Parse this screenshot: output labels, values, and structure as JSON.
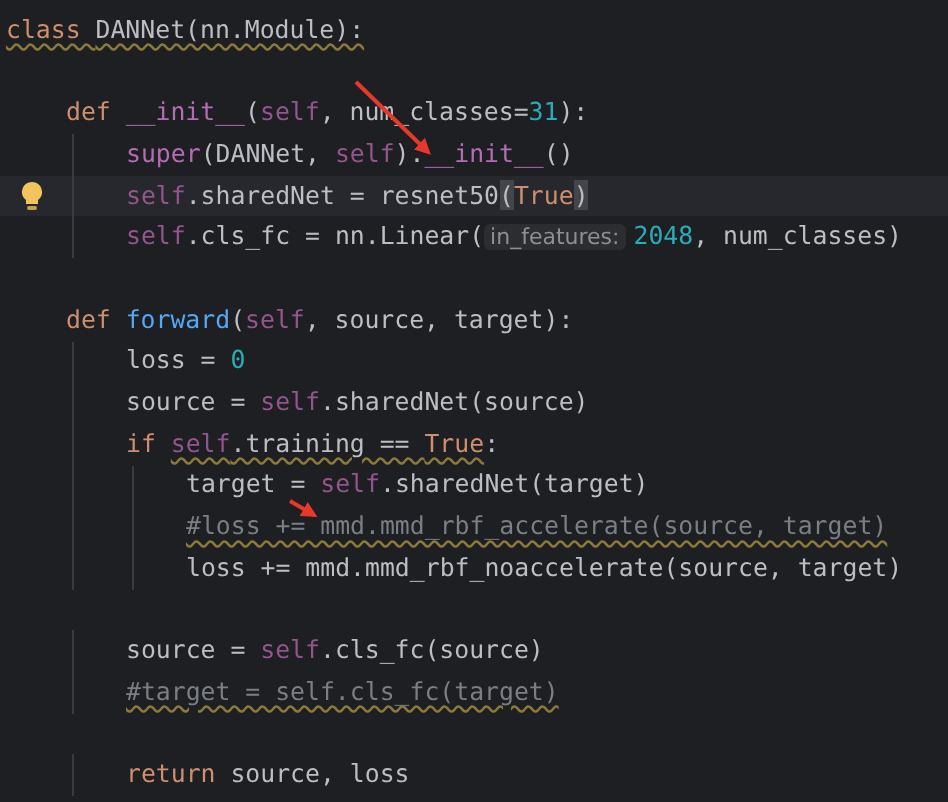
{
  "editor": {
    "lines": [
      {
        "kind": "code",
        "tokens": [
          {
            "t": "class ",
            "kind": "keyword",
            "warn": true
          },
          {
            "t": "DANNet(nn.Module):",
            "kind": "plain",
            "warn": true
          }
        ],
        "children": [
          {
            "kind": "blank"
          },
          {
            "kind": "code",
            "tokens": [
              {
                "t": "def ",
                "kind": "keyword"
              },
              {
                "t": "__init__",
                "kind": "dunder"
              },
              {
                "t": "(",
                "kind": "plain"
              },
              {
                "t": "self",
                "kind": "self"
              },
              {
                "t": ", num_classes=",
                "kind": "plain"
              },
              {
                "t": "31",
                "kind": "number"
              },
              {
                "t": "):",
                "kind": "plain"
              }
            ],
            "children": [
              {
                "kind": "code",
                "tokens": [
                  {
                    "t": "super",
                    "kind": "dunder"
                  },
                  {
                    "t": "(DANNet, ",
                    "kind": "plain"
                  },
                  {
                    "t": "self",
                    "kind": "self"
                  },
                  {
                    "t": ").",
                    "kind": "plain"
                  },
                  {
                    "t": "__init__",
                    "kind": "dunder"
                  },
                  {
                    "t": "()",
                    "kind": "plain"
                  }
                ]
              },
              {
                "kind": "code",
                "current": true,
                "bulb": true,
                "tokens": [
                  {
                    "t": "self",
                    "kind": "self"
                  },
                  {
                    "t": ".sharedNet = resnet50",
                    "kind": "plain"
                  },
                  {
                    "t": "(",
                    "kind": "plain",
                    "match": true
                  },
                  {
                    "t": "True",
                    "kind": "keyword"
                  },
                  {
                    "t": ")",
                    "kind": "plain",
                    "match": true
                  }
                ]
              },
              {
                "kind": "code",
                "tokens": [
                  {
                    "t": "self",
                    "kind": "self"
                  },
                  {
                    "t": ".cls_fc = nn.Linear(",
                    "kind": "plain"
                  },
                  {
                    "t": "in_features:",
                    "kind": "hint"
                  },
                  {
                    "t": "2048",
                    "kind": "number"
                  },
                  {
                    "t": ", num_classes)",
                    "kind": "plain"
                  }
                ]
              }
            ]
          },
          {
            "kind": "blank"
          },
          {
            "kind": "code",
            "tokens": [
              {
                "t": "def ",
                "kind": "keyword"
              },
              {
                "t": "forward",
                "kind": "function"
              },
              {
                "t": "(",
                "kind": "plain"
              },
              {
                "t": "self",
                "kind": "self"
              },
              {
                "t": ", source, target):",
                "kind": "plain"
              }
            ],
            "children": [
              {
                "kind": "code",
                "tokens": [
                  {
                    "t": "loss = ",
                    "kind": "plain"
                  },
                  {
                    "t": "0",
                    "kind": "number"
                  }
                ]
              },
              {
                "kind": "code",
                "tokens": [
                  {
                    "t": "source = ",
                    "kind": "plain"
                  },
                  {
                    "t": "self",
                    "kind": "self"
                  },
                  {
                    "t": ".sharedNet(source)",
                    "kind": "plain"
                  }
                ]
              },
              {
                "kind": "code",
                "tokens": [
                  {
                    "t": "if ",
                    "kind": "keyword"
                  },
                  {
                    "t": "self",
                    "kind": "self",
                    "warn": true
                  },
                  {
                    "t": ".training == ",
                    "kind": "plain",
                    "warn": true
                  },
                  {
                    "t": "True",
                    "kind": "keyword",
                    "warn": true
                  },
                  {
                    "t": ":",
                    "kind": "plain"
                  }
                ],
                "children": [
                  {
                    "kind": "code",
                    "tokens": [
                      {
                        "t": "target = ",
                        "kind": "plain"
                      },
                      {
                        "t": "self",
                        "kind": "self"
                      },
                      {
                        "t": ".sharedNet(target)",
                        "kind": "plain"
                      }
                    ]
                  },
                  {
                    "kind": "code",
                    "tokens": [
                      {
                        "t": "#loss += mmd.mmd_rbf_accelerate(source, target)",
                        "kind": "comment",
                        "warn": true
                      }
                    ]
                  },
                  {
                    "kind": "code",
                    "tokens": [
                      {
                        "t": "loss += mmd.mmd_rbf_noaccelerate(source, target)",
                        "kind": "plain"
                      }
                    ]
                  }
                ]
              },
              {
                "kind": "blank"
              },
              {
                "kind": "code",
                "tokens": [
                  {
                    "t": "source = ",
                    "kind": "plain"
                  },
                  {
                    "t": "self",
                    "kind": "self"
                  },
                  {
                    "t": ".cls_fc(source)",
                    "kind": "plain"
                  }
                ]
              },
              {
                "kind": "code",
                "tokens": [
                  {
                    "t": "#target = self.cls_fc(target)",
                    "kind": "comment",
                    "warn": true
                  }
                ]
              },
              {
                "kind": "blank"
              },
              {
                "kind": "code",
                "tokens": [
                  {
                    "t": "return ",
                    "kind": "keyword"
                  },
                  {
                    "t": "source, loss",
                    "kind": "plain"
                  }
                ]
              }
            ]
          }
        ]
      }
    ]
  }
}
